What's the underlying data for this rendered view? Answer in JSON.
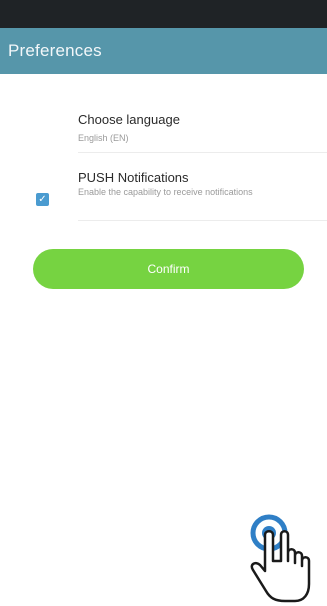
{
  "header": {
    "title": "Preferences"
  },
  "language": {
    "title": "Choose language",
    "value": "English (EN)"
  },
  "push": {
    "title": "PUSH Notifications",
    "description": "Enable the capability to receive notifications",
    "checked": true
  },
  "actions": {
    "confirm_label": "Confirm"
  },
  "icons": {
    "checkbox": "checkmark-icon",
    "gesture": "tap-hand-icon"
  },
  "colors": {
    "app_bar": "#5696aa",
    "status_bar": "#1f2326",
    "confirm_button": "#76d341",
    "checkbox": "#4a9bd0",
    "tap_ring": "#2f7fc6"
  }
}
